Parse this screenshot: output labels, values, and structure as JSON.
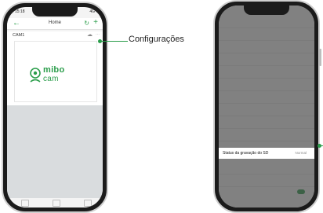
{
  "phone1": {
    "status_time": "15:18",
    "status_right": "4G",
    "header": {
      "title": "Home"
    },
    "camera": {
      "name": "CAM1"
    },
    "logo": {
      "line1": "mibo",
      "line2": "cam"
    }
  },
  "callouts": {
    "settings_label": "Configurações"
  },
  "phone2": {
    "highlight_row": {
      "label": "Status da gravação do SD",
      "value": "Normal"
    }
  },
  "colors": {
    "accent": "#2a9d4a",
    "dim_overlay": "#464646"
  },
  "icons": {
    "back": "back-arrow-icon",
    "refresh": "refresh-icon",
    "add": "add-icon",
    "cloud": "cloud-icon",
    "more": "more-icon",
    "camera_logo": "mibo-camera-icon"
  }
}
